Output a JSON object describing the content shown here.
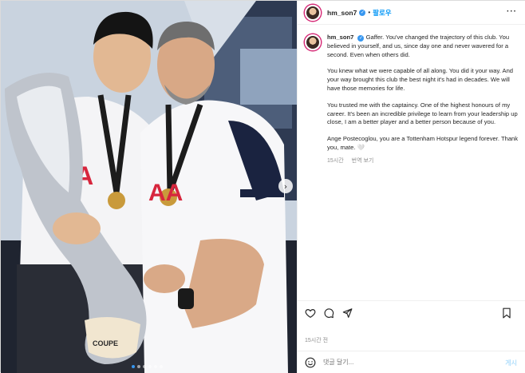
{
  "post": {
    "username": "hm_son7",
    "separator": "•",
    "follow_label": "팔로우",
    "more_icon": "more-horizontal-icon",
    "verified_icon": "verified-badge-icon"
  },
  "caption": {
    "username": "hm_son7",
    "paragraphs": [
      "Gaffer. You've changed the trajectory of this club. You believed in yourself, and us, since day one and never wavered for a second. Even when others did.",
      "You knew what we were capable of all along. You did it your way. And your way brought this club the best night it's had in decades. We will have those memories for life.",
      "You trusted me with the captaincy. One of the highest honours of my career. It's been an incredible privilege to learn from your leadership up close, I am a better player and a better person because of you.",
      "Ange Postecoglou, you are a Tottenham Hotspur legend forever. Thank you, mate. 🤍"
    ],
    "time": "15시간",
    "translate_label": "번역 보기"
  },
  "footer": {
    "time": "15시간 전",
    "comment_placeholder": "댓글 달기...",
    "post_label": "게시"
  },
  "colors": {
    "accent": "#0095f6",
    "verified": "#3897f0",
    "text": "#262626",
    "muted": "#8e8e8e"
  }
}
